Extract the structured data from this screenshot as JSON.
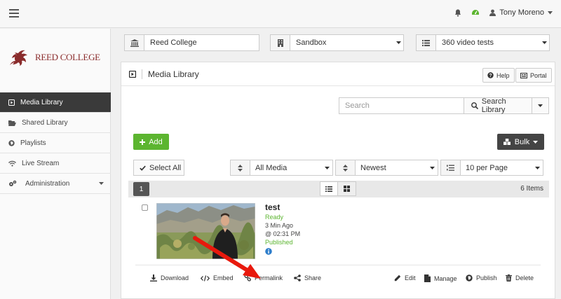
{
  "topbar": {
    "user_name": "Tony Moreno"
  },
  "sidebar": {
    "logo_text": "REED COLLEGE",
    "items": [
      {
        "label": "Media Library"
      },
      {
        "label": "Shared Library"
      },
      {
        "label": "Playlists"
      },
      {
        "label": "Live Stream"
      },
      {
        "label": "Administration"
      }
    ]
  },
  "selectors": {
    "institution": "Reed College",
    "environment": "Sandbox",
    "collection": "360 video tests"
  },
  "panel": {
    "title": "Media Library",
    "help_label": "Help",
    "portal_label": "Portal",
    "search_placeholder": "Search",
    "search_button": "Search Library",
    "add_label": "Add",
    "bulk_label": "Bulk",
    "select_all_label": "Select All",
    "filter_type": "All Media",
    "filter_sort": "Newest",
    "filter_per_page": "10 per Page",
    "page_number": "1",
    "items_count": "6 Items"
  },
  "media_item": {
    "title": "test",
    "status": "Ready",
    "age": "3 Min Ago",
    "time": "@ 02:31 PM",
    "publish_state": "Published"
  },
  "actions": {
    "download": "Download",
    "embed": "Embed",
    "permalink": "Permalink",
    "share": "Share",
    "edit": "Edit",
    "manage": "Manage",
    "publish": "Publish",
    "delete": "Delete"
  }
}
